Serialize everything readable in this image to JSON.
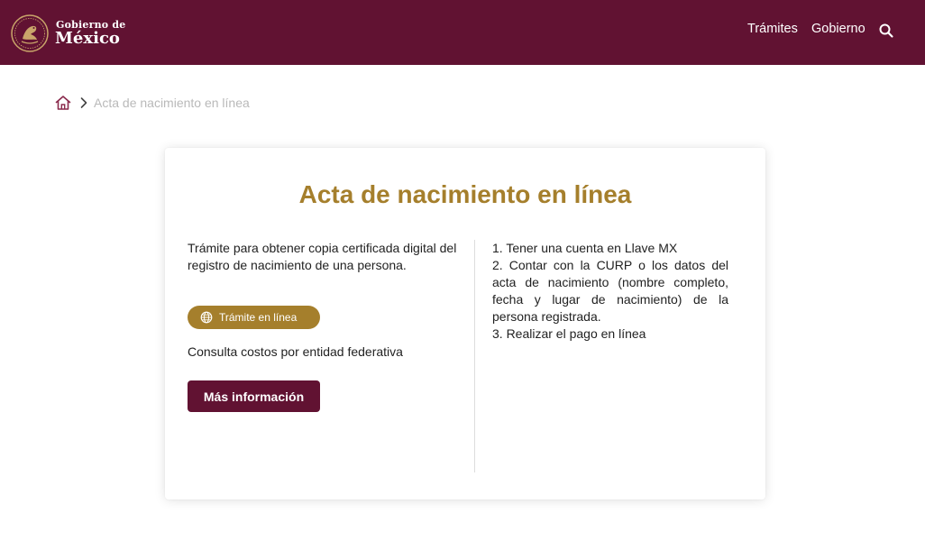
{
  "header": {
    "logo": {
      "line1": "Gobierno de",
      "line2": "México"
    },
    "nav": [
      {
        "label": "Trámites"
      },
      {
        "label": "Gobierno"
      }
    ],
    "search_icon": "search-icon",
    "background_color": "#611232"
  },
  "breadcrumb": {
    "home_icon": "home-icon",
    "separator_icon": "chevron-right-icon",
    "current": "Acta de nacimiento en línea"
  },
  "card": {
    "title": "Acta de nacimiento en línea",
    "description": "Trámite para obtener copia certificada digital del registro de nacimiento de una persona.",
    "online_button": {
      "icon": "globe-icon",
      "label": "Trámite en línea"
    },
    "costs_link": "Consulta costos por entidad federativa",
    "more_info_button": "Más información",
    "requirements": [
      "1. Tener una cuenta en Llave MX",
      "2. Contar con la CURP o los datos del acta de nacimiento (nombre completo, fecha y lugar de nacimiento) de la persona registrada.",
      "3. Realizar el pago en línea"
    ]
  },
  "colors": {
    "brand_guinda": "#611232",
    "gold": "#a57f2c",
    "breadcrumb_gray": "#b9b9b9"
  }
}
